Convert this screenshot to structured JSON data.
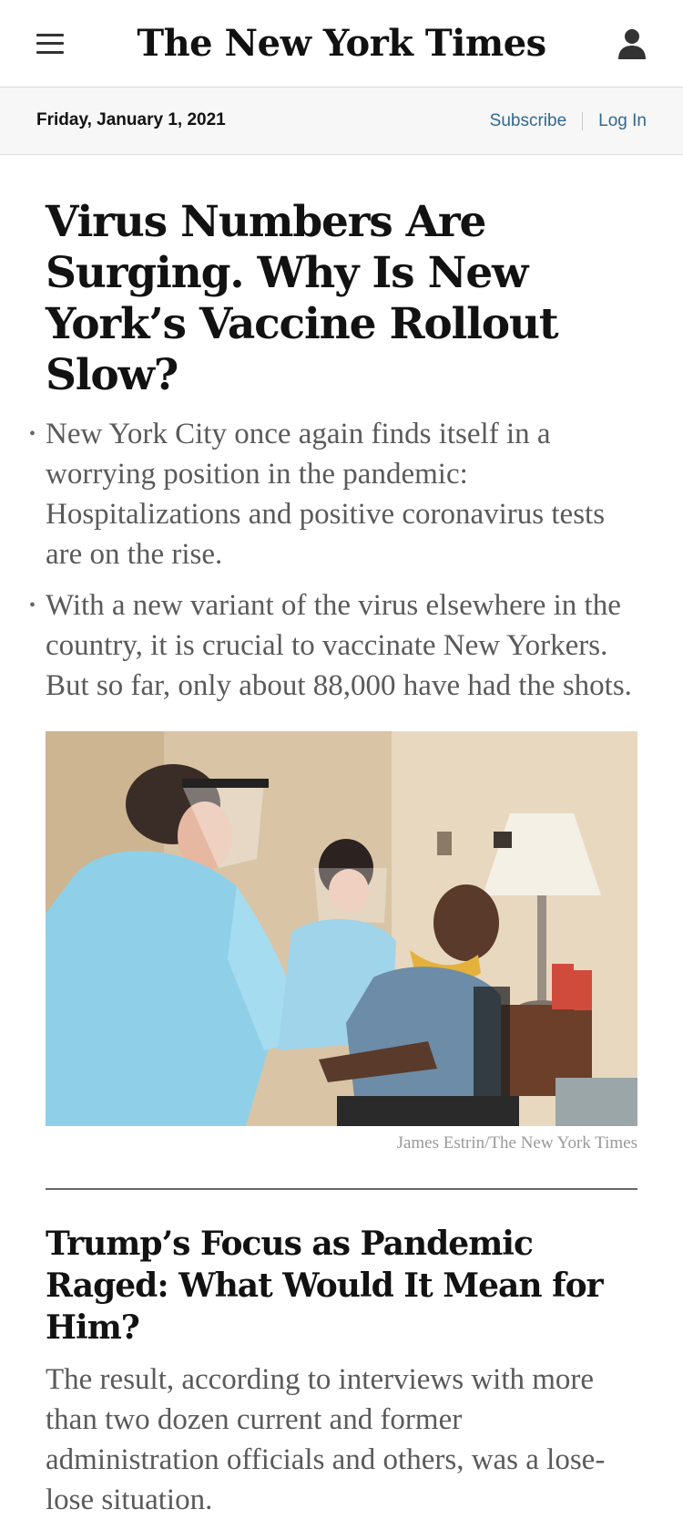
{
  "header": {
    "logo": "The New York Times",
    "menu_icon": "hamburger-menu-icon",
    "account_icon": "user-icon"
  },
  "datebar": {
    "date": "Friday, January 1, 2021",
    "subscribe": "Subscribe",
    "login": "Log In"
  },
  "article1": {
    "headline": "Virus Numbers Are Surging. Why Is New York’s Vaccine Rollout Slow?",
    "bullets": [
      "New York City once again finds itself in a worrying position in the pandemic: Hospitalizations and positive coronavirus tests are on the rise.",
      "With a new variant of the virus elsewhere in the country, it is crucial to vaccinate New Yorkers. But so far, only about 88,000 have had the shots."
    ],
    "photo_credit": "James Estrin/The New York Times"
  },
  "article2": {
    "headline": "Trump’s Focus as Pandemic Raged: What Would It Mean for Him?",
    "summary": "The result, according to interviews with more than two dozen current and former administration officials and others, was a lose-lose situation."
  },
  "colors": {
    "link": "#326891",
    "datebar_bg": "#f7f7f7",
    "summary_text": "#5a5a5a"
  }
}
